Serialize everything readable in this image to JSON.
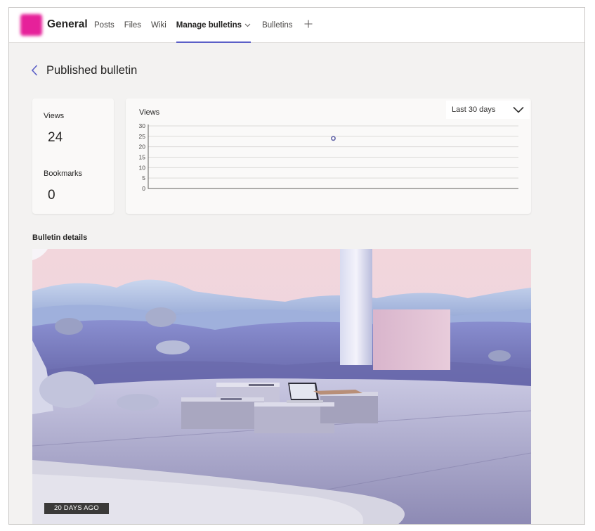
{
  "header": {
    "channel_name": "General",
    "tabs": [
      {
        "label": "Posts",
        "active": false
      },
      {
        "label": "Files",
        "active": false
      },
      {
        "label": "Wiki",
        "active": false
      },
      {
        "label": "Manage bulletins",
        "active": true,
        "has_dropdown": true
      },
      {
        "label": "Bulletins",
        "active": false
      }
    ],
    "add_tab_icon": "plus-icon",
    "accent_color": "#5b5fc7",
    "avatar_color": "#e6219a"
  },
  "page": {
    "title": "Published bulletin",
    "back_icon": "chevron-left-icon"
  },
  "stats": {
    "views_label": "Views",
    "views_value": "24",
    "bookmarks_label": "Bookmarks",
    "bookmarks_value": "0"
  },
  "chart": {
    "range_select": {
      "value": "Last 30 days"
    }
  },
  "chart_data": {
    "type": "scatter",
    "title": "Views",
    "xlabel": "",
    "ylabel": "",
    "ylim": [
      0,
      30
    ],
    "yticks": [
      0,
      5,
      10,
      15,
      20,
      25,
      30
    ],
    "grid": true,
    "series": [
      {
        "values": [
          24
        ],
        "x_fraction": [
          0.5
        ]
      }
    ],
    "point_color": "#6264a7"
  },
  "details": {
    "label": "Bulletin details",
    "date_badge": "20 DAYS AGO"
  }
}
